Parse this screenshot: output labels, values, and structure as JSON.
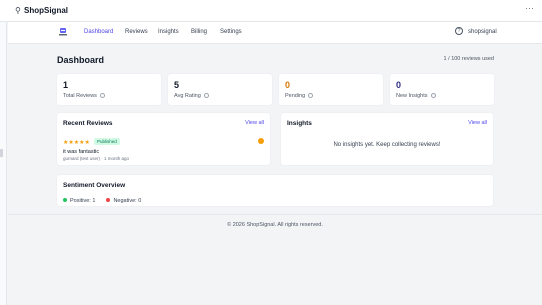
{
  "window": {
    "title": "ShopSignal",
    "menu_glyph": "···"
  },
  "nav": {
    "items": [
      {
        "label": "Dashboard",
        "active": true
      },
      {
        "label": "Reviews"
      },
      {
        "label": "Insights"
      },
      {
        "label": "Billing"
      },
      {
        "label": "Settings"
      }
    ],
    "shop_name": "shopsignal"
  },
  "page": {
    "title": "Dashboard",
    "usage": "1 / 100 reviews used"
  },
  "stats": [
    {
      "value": "1",
      "label": "Total Reviews",
      "color": "#111827"
    },
    {
      "value": "5",
      "label": "Avg Rating",
      "color": "#111827"
    },
    {
      "value": "0",
      "label": "Pending",
      "color": "#d97706"
    },
    {
      "value": "0",
      "label": "New Insights",
      "color": "#312e81"
    }
  ],
  "recent_reviews": {
    "title": "Recent Reviews",
    "view_all": "View all",
    "items": [
      {
        "stars": 5,
        "status": "Published",
        "text": "it was fantastic",
        "meta": "gurnard (test user) · 1 month ago"
      }
    ]
  },
  "insights": {
    "title": "Insights",
    "view_all": "View all",
    "empty": "No insights yet. Keep collecting reviews!"
  },
  "sentiment": {
    "title": "Sentiment Overview",
    "positive": "Positive: 1",
    "negative": "Negative: 0",
    "positive_color": "#22c55e",
    "negative_color": "#ef4444"
  },
  "footer": {
    "text": "© 2026 ShopSignal. All rights reserved."
  },
  "colors": {
    "accent": "#4f46e5",
    "star": "#f59e0b"
  }
}
